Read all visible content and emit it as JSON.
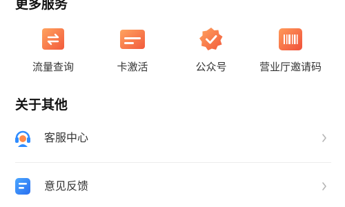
{
  "sections": {
    "more_services": {
      "title": "更多服务",
      "items": [
        {
          "label": "流量查询",
          "icon": "data-exchange-icon"
        },
        {
          "label": "卡激活",
          "icon": "card-icon"
        },
        {
          "label": "公众号",
          "icon": "verified-badge-icon"
        },
        {
          "label": "营业厅邀请码",
          "icon": "barcode-icon"
        }
      ]
    },
    "about_other": {
      "title": "关于其他",
      "items": [
        {
          "label": "客服中心",
          "icon": "customer-service-headset-icon"
        },
        {
          "label": "意见反馈",
          "icon": "feedback-document-icon"
        }
      ]
    }
  },
  "colors": {
    "accent_orange": "#f46b45",
    "accent_orange_light": "#ffa35f",
    "service_blue": "#2f8cff",
    "chevron_gray": "#b5b5b5"
  }
}
